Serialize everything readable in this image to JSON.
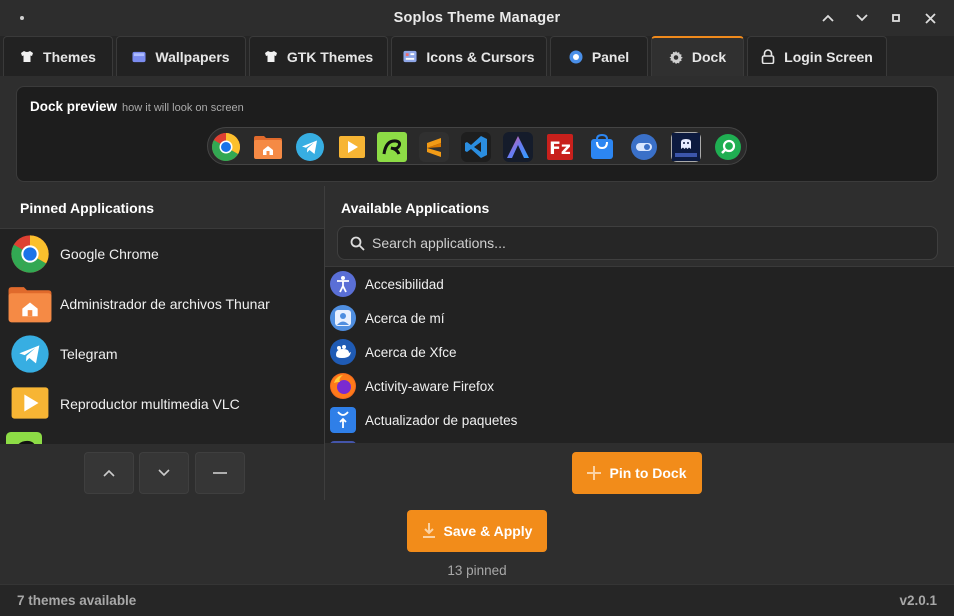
{
  "window": {
    "title": "Soplos Theme Manager",
    "controls": [
      "minimize",
      "maximize",
      "close"
    ]
  },
  "tabs": [
    {
      "label": "Themes",
      "icon": "shirt-icon",
      "active": false
    },
    {
      "label": "Wallpapers",
      "icon": "image-icon",
      "active": false
    },
    {
      "label": "GTK Themes",
      "icon": "shirt-icon",
      "active": false
    },
    {
      "label": "Icons & Cursors",
      "icon": "icons-icon",
      "active": false
    },
    {
      "label": "Panel",
      "icon": "panel-icon",
      "active": false
    },
    {
      "label": "Dock",
      "icon": "gear-icon",
      "active": true
    },
    {
      "label": "Login Screen",
      "icon": "lock-icon",
      "active": false
    }
  ],
  "preview": {
    "title": "Dock preview",
    "subtitle": "how it will look on screen",
    "dock_icons": [
      "chrome-icon",
      "folder-home-icon",
      "telegram-icon",
      "vlc-icon",
      "arduino-icon",
      "sublime-text-icon",
      "vscode-icon",
      "arch-icon",
      "filezilla-icon",
      "store-bag-icon",
      "toggle-icon",
      "terminal-ghost-icon",
      "search-magnifier-icon"
    ]
  },
  "pinned": {
    "heading": "Pinned Applications",
    "items": [
      {
        "label": "Google Chrome",
        "icon": "chrome-icon"
      },
      {
        "label": "Administrador de archivos Thunar",
        "icon": "folder-home-icon"
      },
      {
        "label": "Telegram",
        "icon": "telegram-icon"
      },
      {
        "label": "Reproductor multimedia VLC",
        "icon": "vlc-icon"
      },
      {
        "label": "",
        "icon": "arduino-icon"
      }
    ],
    "controls": [
      "move-up",
      "move-down",
      "remove"
    ]
  },
  "available": {
    "heading": "Available Applications",
    "search_placeholder": "Search applications...",
    "items": [
      {
        "label": "Accesibilidad",
        "icon": "accessibility-icon"
      },
      {
        "label": "Acerca de mí",
        "icon": "user-icon"
      },
      {
        "label": "Acerca de Xfce",
        "icon": "xfce-mouse-icon"
      },
      {
        "label": "Activity-aware Firefox",
        "icon": "firefox-icon"
      },
      {
        "label": "Actualizador de paquetes",
        "icon": "package-update-icon"
      }
    ]
  },
  "buttons": {
    "pin": "Pin to Dock",
    "save": "Save & Apply"
  },
  "pinned_count": "13 pinned",
  "status": {
    "left": "7 themes available",
    "right": "v2.0.1"
  },
  "colors": {
    "accent": "#f28c1a",
    "background": "#2e2e2e",
    "list_background": "#222222"
  }
}
